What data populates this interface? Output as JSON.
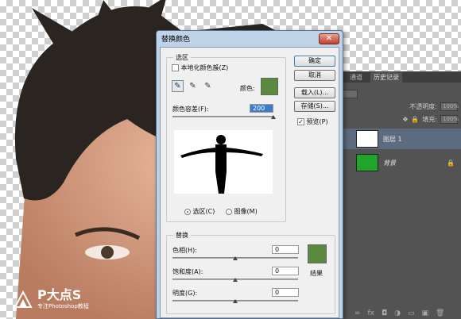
{
  "dialog": {
    "title": "替换颜色",
    "close": "✕",
    "selection_group": "选区",
    "localized_label": "本地化颜色簇(Z)",
    "color_label": "颜色:",
    "color_hex": "#5a8a3e",
    "fuzziness_label": "颜色容差(F):",
    "fuzziness_value": "200",
    "selection_radio": "选区(C)",
    "image_radio": "图像(M)",
    "replace_group": "替换",
    "hue_label": "色相(H):",
    "hue_value": "0",
    "saturation_label": "饱和度(A):",
    "saturation_value": "0",
    "lightness_label": "明度(G):",
    "lightness_value": "0",
    "result_label": "结果",
    "result_hex": "#5a8a3e",
    "ok": "确定",
    "cancel": "取消",
    "load": "载入(L)...",
    "save": "存储(S)...",
    "preview_label": "预览(P)"
  },
  "layers_panel": {
    "tabs": [
      "通道",
      "历史记录"
    ],
    "opacity_label": "不透明度:",
    "opacity_value": "100%",
    "fill_label": "填充:",
    "fill_value": "100%",
    "layers": [
      {
        "name": "图层 1",
        "selected": true
      },
      {
        "name": "背景",
        "selected": false
      }
    ]
  },
  "watermark": {
    "title": "P大点S",
    "subtitle": "专注Photoshop教程"
  }
}
